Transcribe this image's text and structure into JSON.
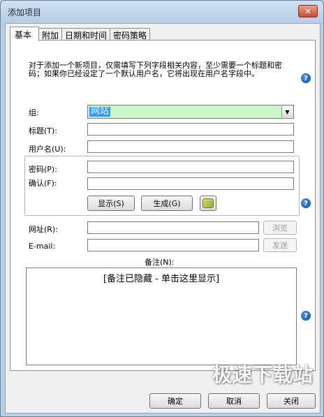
{
  "window": {
    "title": "添加项目",
    "close_glyph": "✕"
  },
  "tabs": [
    {
      "label": "基本"
    },
    {
      "label": "附加"
    },
    {
      "label": "日期和时间"
    },
    {
      "label": "密码策略"
    }
  ],
  "intro": "对于添加一个新项目，仅需填写下列字段相关内容，至少需要一个标题和密码；如果你已经设定了一个默认用户名，它将出现在用户名字段中。",
  "help_glyph": "?",
  "form": {
    "group_label": "组:",
    "group_value": "网站",
    "title_label": "标题(T):",
    "title_value": "",
    "username_label": "用户名(U):",
    "username_value": "",
    "password_label": "密码(P):",
    "password_value": "",
    "confirm_label": "确认(F):",
    "confirm_value": "",
    "show_button": "显示(S)",
    "generate_button": "生成(G)",
    "url_label": "网址(R):",
    "url_value": "",
    "browse_button": "浏览",
    "email_label": "E-mail:",
    "email_value": "",
    "send_button": "发送",
    "notes_label": "备注(N):",
    "notes_placeholder": "[备注已隐藏 - 单击这里显示]"
  },
  "footer": {
    "ok_button": "确定",
    "cancel_button": "取消",
    "partial_button": "关闭"
  },
  "watermark": "极速下载站"
}
